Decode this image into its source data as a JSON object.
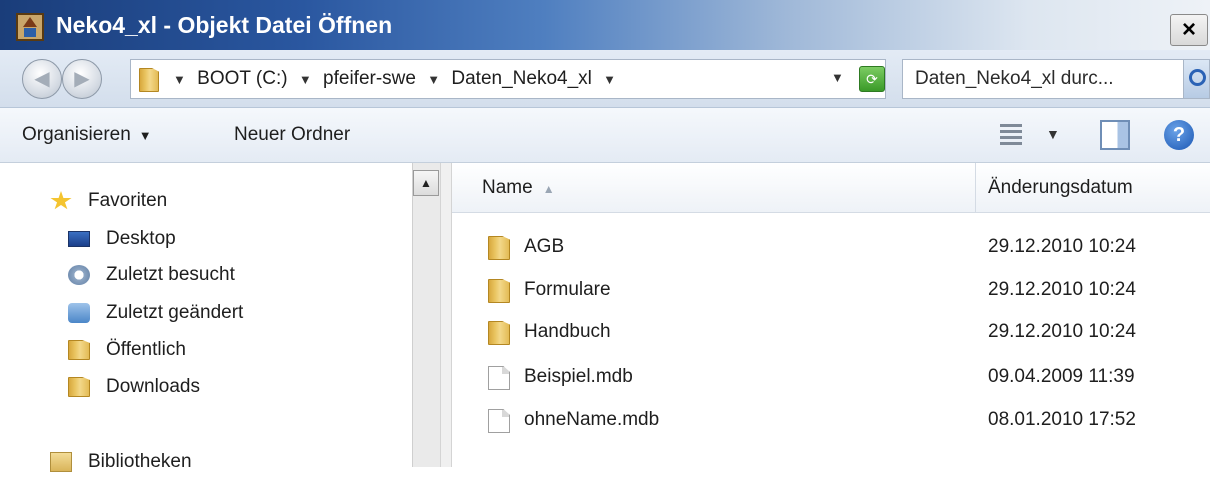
{
  "window": {
    "title": "Neko4_xl - Objekt Datei Öffnen",
    "close_glyph": "×"
  },
  "address": {
    "crumb_arrow": "▼",
    "crumbs": [
      "BOOT (C:)",
      "pfeifer-swe",
      "Daten_Neko4_xl"
    ],
    "dropdown_glyph": "▼",
    "refresh_glyph": "⟳",
    "search_text": "Daten_Neko4_xl durc..."
  },
  "toolbar": {
    "organize_label": "Organisieren",
    "new_folder_label": "Neuer Ordner",
    "caret": "▼",
    "help_glyph": "?"
  },
  "nav": {
    "scroll_up_glyph": "▲",
    "favorites": "Favoriten",
    "items": [
      {
        "label": "Desktop",
        "icon": "desktop-icon"
      },
      {
        "label": "Zuletzt besucht",
        "icon": "recent-places-icon"
      },
      {
        "label": "Zuletzt geändert",
        "icon": "recently-changed-icon"
      },
      {
        "label": "Öffentlich",
        "icon": "folder-icon"
      },
      {
        "label": "Downloads",
        "icon": "downloads-folder-icon"
      }
    ],
    "libraries": "Bibliotheken"
  },
  "list": {
    "columns": {
      "name": "Name",
      "date": "Änderungsdatum"
    },
    "sort_glyph": "▲",
    "rows": [
      {
        "name": "AGB",
        "date": "29.12.2010 10:24",
        "type": "folder"
      },
      {
        "name": "Formulare",
        "date": "29.12.2010 10:24",
        "type": "folder"
      },
      {
        "name": "Handbuch",
        "date": "29.12.2010 10:24",
        "type": "folder"
      },
      {
        "name": "Beispiel.mdb",
        "date": "09.04.2009 11:39",
        "type": "file"
      },
      {
        "name": "ohneName.mdb",
        "date": "08.01.2010 17:52",
        "type": "file"
      }
    ]
  }
}
